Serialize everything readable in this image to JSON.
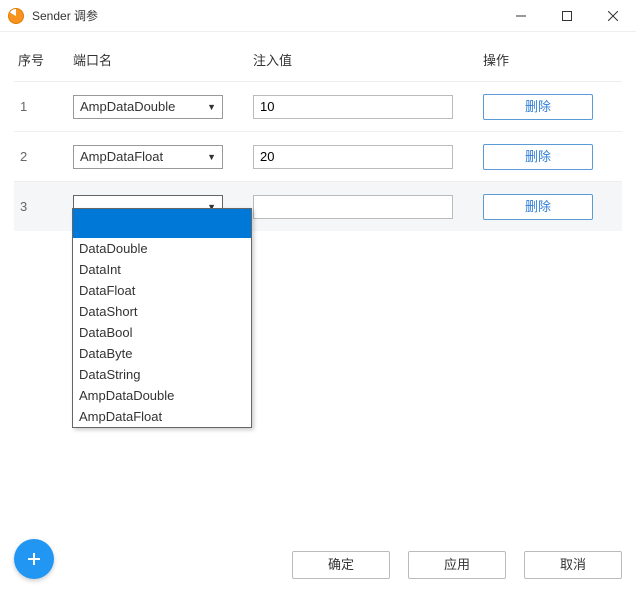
{
  "window": {
    "title": "Sender 调参"
  },
  "columns": {
    "seq": "序号",
    "port": "端口名",
    "value": "注入值",
    "action": "操作"
  },
  "rows": [
    {
      "seq": "1",
      "port": "AmpDataDouble",
      "value": "10",
      "delete": "删除"
    },
    {
      "seq": "2",
      "port": "AmpDataFloat",
      "value": "20",
      "delete": "删除"
    },
    {
      "seq": "3",
      "port": "",
      "value": "",
      "delete": "删除"
    }
  ],
  "dropdown_options": [
    "DataDouble",
    "DataInt",
    "DataFloat",
    "DataShort",
    "DataBool",
    "DataByte",
    "DataString",
    "AmpDataDouble",
    "AmpDataFloat"
  ],
  "footer": {
    "ok": "确定",
    "apply": "应用",
    "cancel": "取消"
  }
}
